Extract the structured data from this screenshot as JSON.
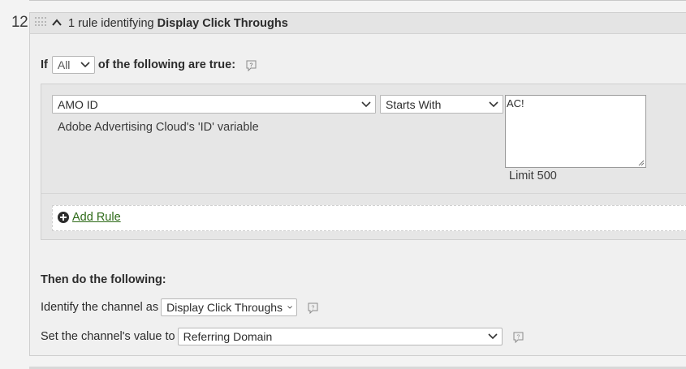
{
  "rule": {
    "number": "12",
    "header_prefix": "1 rule identifying",
    "header_name": "Display Click Throughs"
  },
  "condition": {
    "if_label": "If",
    "match_selected": "All",
    "suffix_label": "of the following are true:",
    "field_selected": "AMO ID",
    "field_description": "Adobe Advertising Cloud's 'ID' variable",
    "operator_selected": "Starts With",
    "value": "AC!",
    "limit_text": "Limit 500",
    "add_rule_label": "Add Rule"
  },
  "actions": {
    "title": "Then do the following:",
    "identify_label": "Identify the channel as",
    "channel_selected": "Display Click Throughs",
    "value_label": "Set the channel's value to",
    "value_selected": "Referring Domain"
  },
  "colors": {
    "link_green": "#2d6a17",
    "panel_bg": "#f0f0f0",
    "header_bg": "#e4e4e4"
  },
  "icons": [
    "drag-handle-icon",
    "chevron-up-icon",
    "help-icon",
    "chevron-down-icon",
    "add-circle-icon",
    "resize-grip-icon"
  ]
}
